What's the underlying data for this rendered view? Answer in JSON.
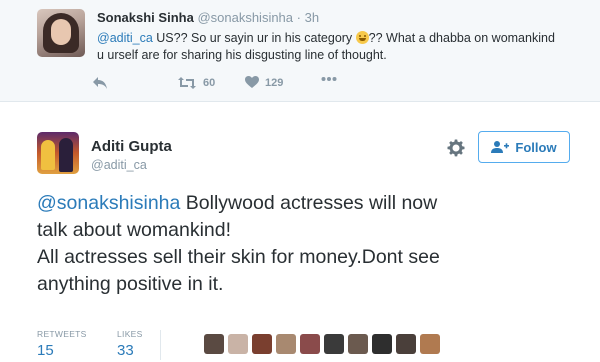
{
  "reply": {
    "name": "Sonakshi Sinha",
    "handle": "@sonakshisinha",
    "separator": "·",
    "time": "3h",
    "mention": "@aditi_ca",
    "text_part1": " US?? So ur sayin ur in his category ",
    "text_part2": "?? What a dhabba on womankind u urself are for sharing his disgusting line of thought.",
    "retweet_count": "60",
    "like_count": "129"
  },
  "tweet": {
    "name": "Aditi Gupta",
    "handle": "@aditi_ca",
    "follow_label": "Follow",
    "mention": "@sonakshisinha",
    "line1_rest": " Bollywood actresses will now",
    "line2": "talk about womankind!",
    "line3": "All actresses sell their skin for money.Dont see",
    "line4": "anything positive in it.",
    "retweets_label": "RETWEETS",
    "retweets_value": "15",
    "likes_label": "LIKES",
    "likes_value": "33"
  },
  "colors": {
    "link": "#2b7bb9",
    "muted": "#8899a6",
    "text": "#292f33",
    "follow_border": "#55acee"
  },
  "icons": [
    "reply-icon",
    "retweet-icon",
    "heart-icon",
    "more-icon",
    "gear-icon",
    "follow-user-icon"
  ],
  "liker_avatars": [
    "#5a4a42",
    "#c9b3a6",
    "#7a3f2f",
    "#a88970",
    "#8a4b4b",
    "#3a3a3a",
    "#6b5a4f",
    "#2e2e2e",
    "#4a3f3a",
    "#b07a50"
  ]
}
